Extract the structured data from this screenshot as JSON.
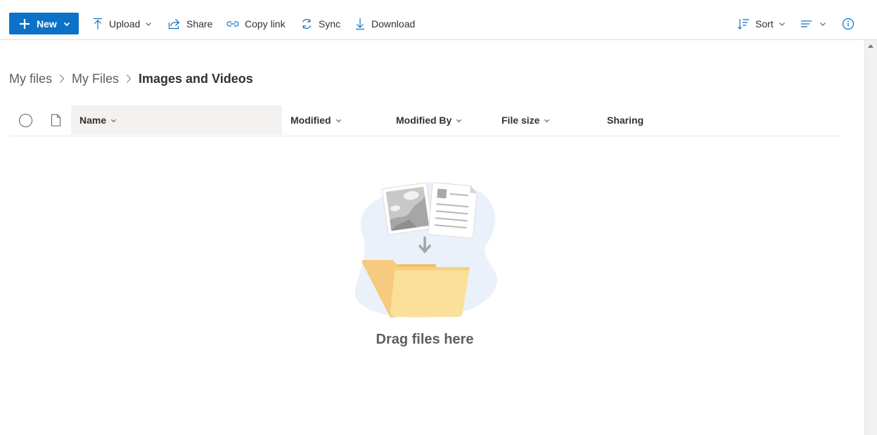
{
  "toolbar": {
    "new_label": "New",
    "upload_label": "Upload",
    "share_label": "Share",
    "copy_link_label": "Copy link",
    "sync_label": "Sync",
    "download_label": "Download",
    "sort_label": "Sort"
  },
  "breadcrumb": {
    "items": [
      "My files",
      "My Files"
    ],
    "current": "Images and Videos"
  },
  "columns": {
    "name": "Name",
    "modified": "Modified",
    "modified_by": "Modified By",
    "file_size": "File size",
    "sharing": "Sharing"
  },
  "empty_state": {
    "message": "Drag files here"
  },
  "colors": {
    "accent": "#0b72c8",
    "text": "#323130",
    "secondary_text": "#605e5c"
  }
}
